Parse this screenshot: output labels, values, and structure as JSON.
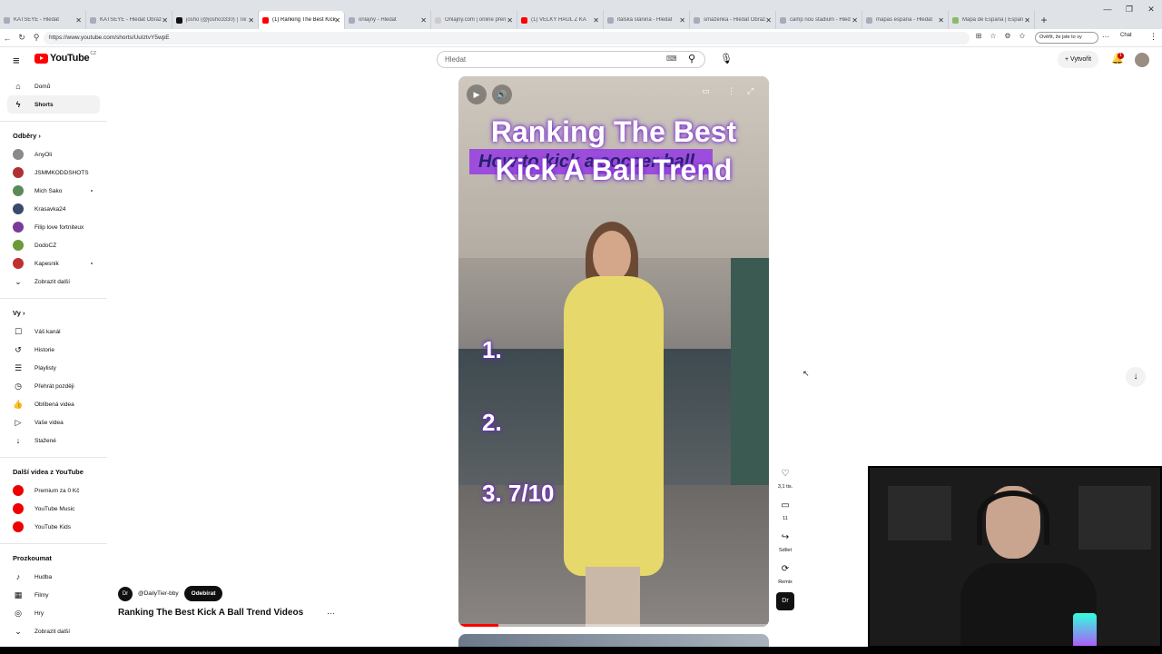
{
  "browser": {
    "tabs": [
      {
        "label": "KATSEYE - Hledat",
        "color": "#aab"
      },
      {
        "label": "KATSEYE - Hledat Obráz",
        "color": "#aab"
      },
      {
        "label": "josho (@josho3330) | Tik",
        "color": "#111"
      },
      {
        "label": "(1) Ranking The Best Kick",
        "color": "#f00",
        "active": true
      },
      {
        "label": "onlajny - Hledat",
        "color": "#aab"
      },
      {
        "label": "Onlajny.com | online přen",
        "color": "#ccc"
      },
      {
        "label": "(1) VELKÝ HAUL Z KA",
        "color": "#f00"
      },
      {
        "label": "italská slanina - Hledat",
        "color": "#aab"
      },
      {
        "label": "smaženka - Hledat Obráz",
        "color": "#aab"
      },
      {
        "label": "camp nou stadium - Hled",
        "color": "#aab"
      },
      {
        "label": "mapas espana - Hledat",
        "color": "#aab"
      },
      {
        "label": "Mapa de España | Españ",
        "color": "#8b6"
      }
    ],
    "url": "https://www.youtube.com/shorts/UuIztvY5wpE",
    "verify_label": "Ověřit, že jste to vy",
    "chat_label": "Chat"
  },
  "header": {
    "logo": "YouTube",
    "region": "CZ",
    "search_placeholder": "Hledat",
    "create_label": "Vytvořit",
    "notif_count": "1"
  },
  "sidebar": {
    "main": [
      {
        "label": "Domů",
        "icon": "⌂"
      },
      {
        "label": "Shorts",
        "icon": "ϟ",
        "active": true
      }
    ],
    "subs_header": "Odběry",
    "subs": [
      {
        "label": "AnyOli",
        "color": "#8a8a8a",
        "dot": false
      },
      {
        "label": "JSMMKODDSHOTS",
        "color": "#b03030",
        "dot": false
      },
      {
        "label": "Mich Sako",
        "color": "#5a8a5a",
        "dot": true
      },
      {
        "label": "Krasavka24",
        "color": "#3a4a6a",
        "dot": false
      },
      {
        "label": "Filip love fortniteux",
        "color": "#7a3a9a",
        "dot": false
      },
      {
        "label": "DodoCZ",
        "color": "#6a9a3a",
        "dot": false
      },
      {
        "label": "Kapesnik",
        "color": "#c03030",
        "dot": true
      }
    ],
    "subs_more": "Zobrazit další",
    "you_header": "Vy",
    "you": [
      {
        "label": "Váš kanál",
        "icon": "☐"
      },
      {
        "label": "Historie",
        "icon": "↺"
      },
      {
        "label": "Playlisty",
        "icon": "☰"
      },
      {
        "label": "Přehrát později",
        "icon": "◷"
      },
      {
        "label": "Oblíbená videa",
        "icon": "👍"
      },
      {
        "label": "Vaše videa",
        "icon": "▷"
      },
      {
        "label": "Stažené",
        "icon": "↓"
      }
    ],
    "more_header": "Další videa z YouTube",
    "more": [
      {
        "label": "Premium za 0 Kč",
        "color": "#e00"
      },
      {
        "label": "YouTube Music",
        "color": "#e00"
      },
      {
        "label": "YouTube Kids",
        "color": "#e00"
      }
    ],
    "explore_header": "Prozkoumat",
    "explore": [
      {
        "label": "Hudba",
        "icon": "♪"
      },
      {
        "label": "Filmy",
        "icon": "▦"
      },
      {
        "label": "Hry",
        "icon": "◎"
      }
    ],
    "explore_more": "Zobrazit další"
  },
  "short": {
    "overlay_title": "Ranking The Best Kick A Ball Trend",
    "overlay_sub": "How to kick a soccer ball",
    "rank1": "1.",
    "rank2": "2.",
    "rank3": "3.  7/10",
    "progress": 0.13,
    "channel": "@DailyTier-bby",
    "channel_initials": "Dr",
    "subscribe": "Odebírat",
    "title": "Ranking The Best Kick A Ball Trend Videos",
    "likes": "3,1 tis.",
    "comments": "11",
    "share": "Sdílet",
    "remix": "Remix"
  }
}
